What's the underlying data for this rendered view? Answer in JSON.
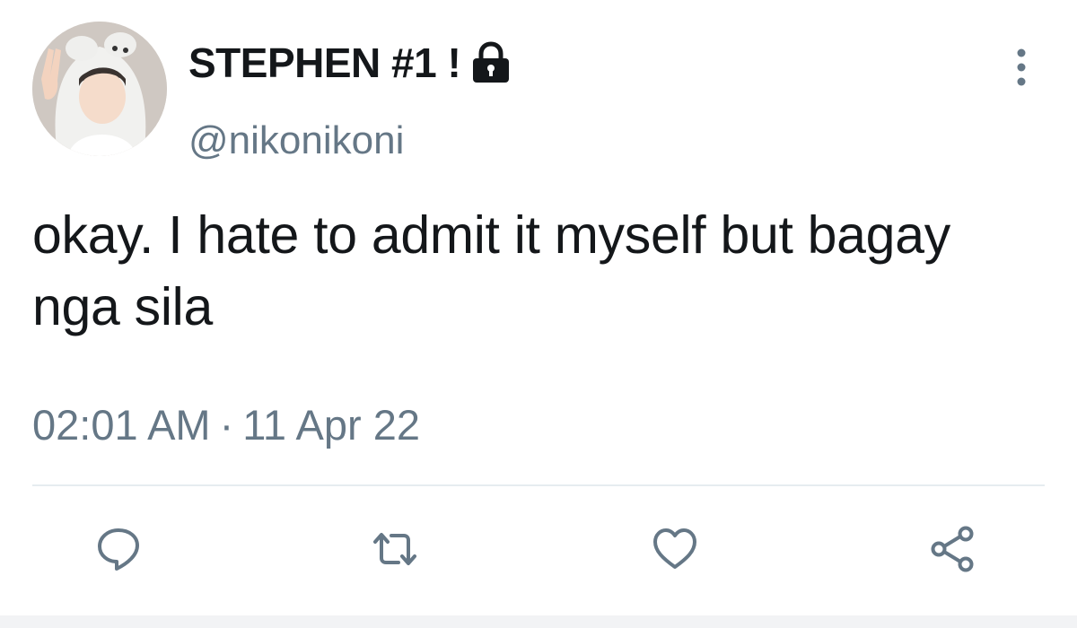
{
  "tweet": {
    "display_name": "STEPHEN #1 !",
    "handle": "@nikonikoni",
    "text": "okay. I hate to admit it myself but bagay nga sila",
    "time": "02:01 AM",
    "separator": "·",
    "date": "11 Apr 22",
    "protected_icon": "lock-icon"
  },
  "actions": [
    {
      "icon": "reply-icon"
    },
    {
      "icon": "retweet-icon"
    },
    {
      "icon": "like-icon"
    },
    {
      "icon": "share-icon"
    }
  ],
  "colors": {
    "text": "#14171a",
    "secondary": "#657786",
    "divider": "#e6ecf0",
    "background": "#ffffff"
  }
}
